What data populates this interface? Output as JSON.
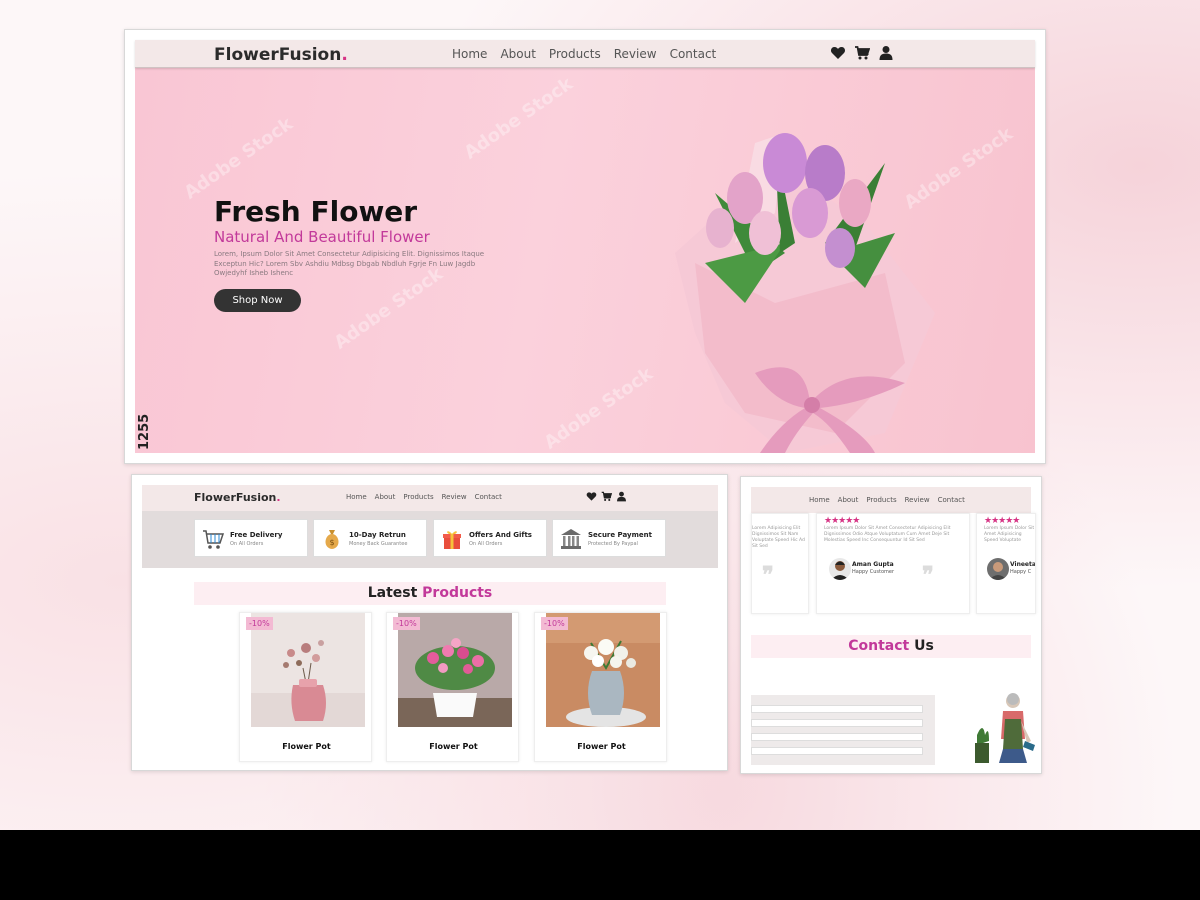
{
  "hero": {
    "nav": {
      "brand": "FlowerFusion",
      "brand_dot": ".",
      "links": [
        "Home",
        "About",
        "Products",
        "Review",
        "Contact"
      ],
      "icons": [
        "heart-icon",
        "cart-icon",
        "user-icon"
      ]
    },
    "title": "Fresh Flower",
    "subtitle": "Natural And Beautiful Flower",
    "description": "Lorem, Ipsum Dolor Sit Amet Consectetur Adipisicing Elit. Dignissimos Itaque Exceptun Hic? Lorem Sbv Ashdiu Mdbsg Dbgab Nbdluh Fgrje Fn Luw Jagdb Owjedyhf Isheb Ishenc",
    "shop_button": "Shop Now",
    "watermark": "Adobe Stock",
    "side_number": "1255"
  },
  "products_page": {
    "nav": {
      "brand": "FlowerFusion",
      "brand_dot": ".",
      "links": [
        "Home",
        "About",
        "Products",
        "Review",
        "Contact"
      ],
      "icons": [
        "heart-icon",
        "cart-icon",
        "user-icon"
      ]
    },
    "services": [
      {
        "title": "Free Delivery",
        "subtitle": "On All Orders",
        "icon": "cart-icon"
      },
      {
        "title": "10-Day Retrun",
        "subtitle": "Money Back Guarantee",
        "icon": "money-bag-icon"
      },
      {
        "title": "Offers And Gifts",
        "subtitle": "On All Orders",
        "icon": "gift-icon"
      },
      {
        "title": "Secure Payment",
        "subtitle": "Protected By Paypal",
        "icon": "bank-icon"
      }
    ],
    "section_title_plain": "Latest",
    "section_title_accent": "Products",
    "products": [
      {
        "name": "Flower Pot",
        "badge": "-10%"
      },
      {
        "name": "Flower Pot",
        "badge": "-10%"
      },
      {
        "name": "Flower Pot",
        "badge": "-10%"
      }
    ]
  },
  "contact_page": {
    "nav": {
      "links": [
        "Home",
        "About",
        "Products",
        "Review",
        "Contact"
      ]
    },
    "reviews": [
      {
        "text": "Lorem Adipisicing Elit Dignissimos Sit Nam Voluptate Speed Hic Ad Sit Sed",
        "stars": "",
        "name": "",
        "role": ""
      },
      {
        "text": "Lorem Ipsum Dolor Sit Amet Consectetur Adipisicing Elit Dignissimos Odio Atque Voluptatum Cum Amet Deje Sit Molestias Speed Inc Consequuntur Id Sit Sed",
        "stars": "★★★★★",
        "name": "Aman Gupta",
        "role": "Happy Customer"
      },
      {
        "text": "Lorem Ipsum Dolor Sit Amet Adipisicing Speed Voluptate",
        "stars": "★★★★★",
        "name": "Vineeta",
        "role": "Happy C"
      }
    ],
    "contact_title_accent": "Contact",
    "contact_title_plain": "Us"
  }
}
